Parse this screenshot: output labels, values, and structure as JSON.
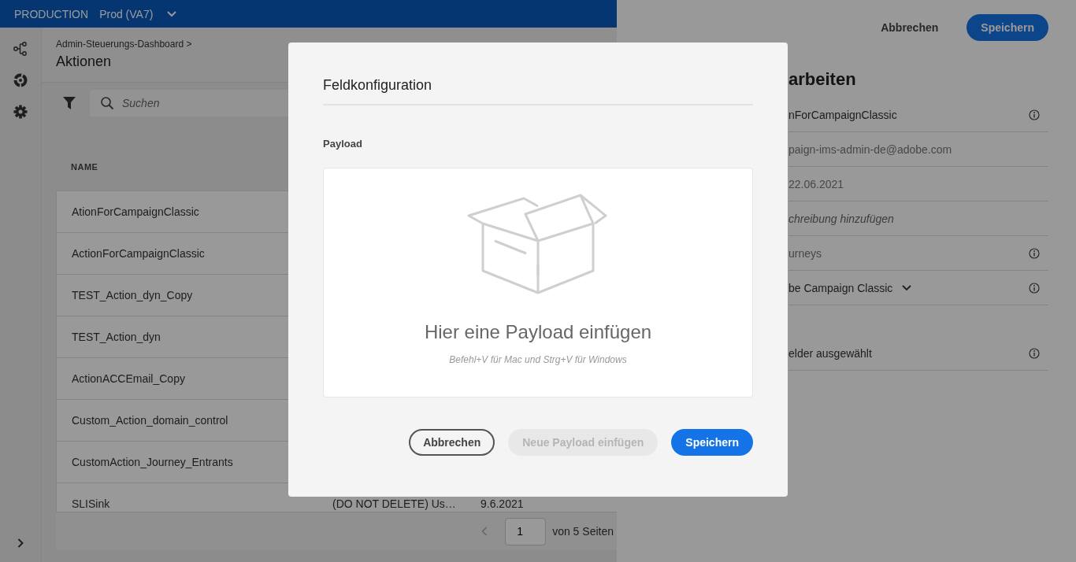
{
  "top_bar": {
    "label": "PRODUCTION",
    "sandbox": "Prod (VA7)"
  },
  "breadcrumb": "Admin-Steuerungs-Dashboard >",
  "page_title": "Aktionen",
  "search": {
    "placeholder": "Suchen"
  },
  "table": {
    "columns": [
      "NAME"
    ],
    "rows": [
      {
        "name": "AtionForCampaignClassic"
      },
      {
        "name": "ActionForCampaignClassic"
      },
      {
        "name": "TEST_Action_dyn_Copy"
      },
      {
        "name": "TEST_Action_dyn"
      },
      {
        "name": "ActionACCEmail_Copy"
      },
      {
        "name": "Custom_Action_domain_control"
      },
      {
        "name": "CustomAction_Journey_Entrants"
      },
      {
        "name": "SLISink",
        "column_2": "(DO NOT DELETE) Us…",
        "column_3": "9.6.2021"
      }
    ]
  },
  "pagination": {
    "page": "1",
    "of_pages": "von 5 Seiten"
  },
  "drawer": {
    "buttons": [
      {
        "label": "Abbrechen",
        "kind": "quiet"
      },
      {
        "label": "Speichern",
        "kind": "primary"
      }
    ],
    "heading": "arbeiten",
    "rows": [
      {
        "text": "nForCampaignClassic",
        "kind": "value",
        "info": true
      },
      {
        "text": "paign-ims-admin-de@adobe.com",
        "kind": "muted",
        "info": false
      },
      {
        "text": "22.06.2021",
        "kind": "muted",
        "info": false
      },
      {
        "text": "chreibung hinzufügen",
        "kind": "placeholder",
        "info": false
      },
      {
        "text": "urneys",
        "kind": "muted",
        "info": true
      },
      {
        "text": "be Campaign Classic",
        "kind": "dropdown",
        "info": true
      }
    ],
    "field_selection": {
      "text": "elder ausgewählt",
      "info": true
    }
  },
  "modal": {
    "title": "Feldkonfiguration",
    "label": "Payload",
    "drop_title": "Hier eine Payload einfügen",
    "drop_hint": "Befehl+V für Mac und Strg+V für Windows",
    "buttons": [
      {
        "label": "Abbrechen",
        "kind": "outline",
        "disabled": false
      },
      {
        "label": "Neue Payload einfügen",
        "kind": "secondary",
        "disabled": true
      },
      {
        "label": "Speichern",
        "kind": "primary",
        "disabled": false
      }
    ]
  }
}
